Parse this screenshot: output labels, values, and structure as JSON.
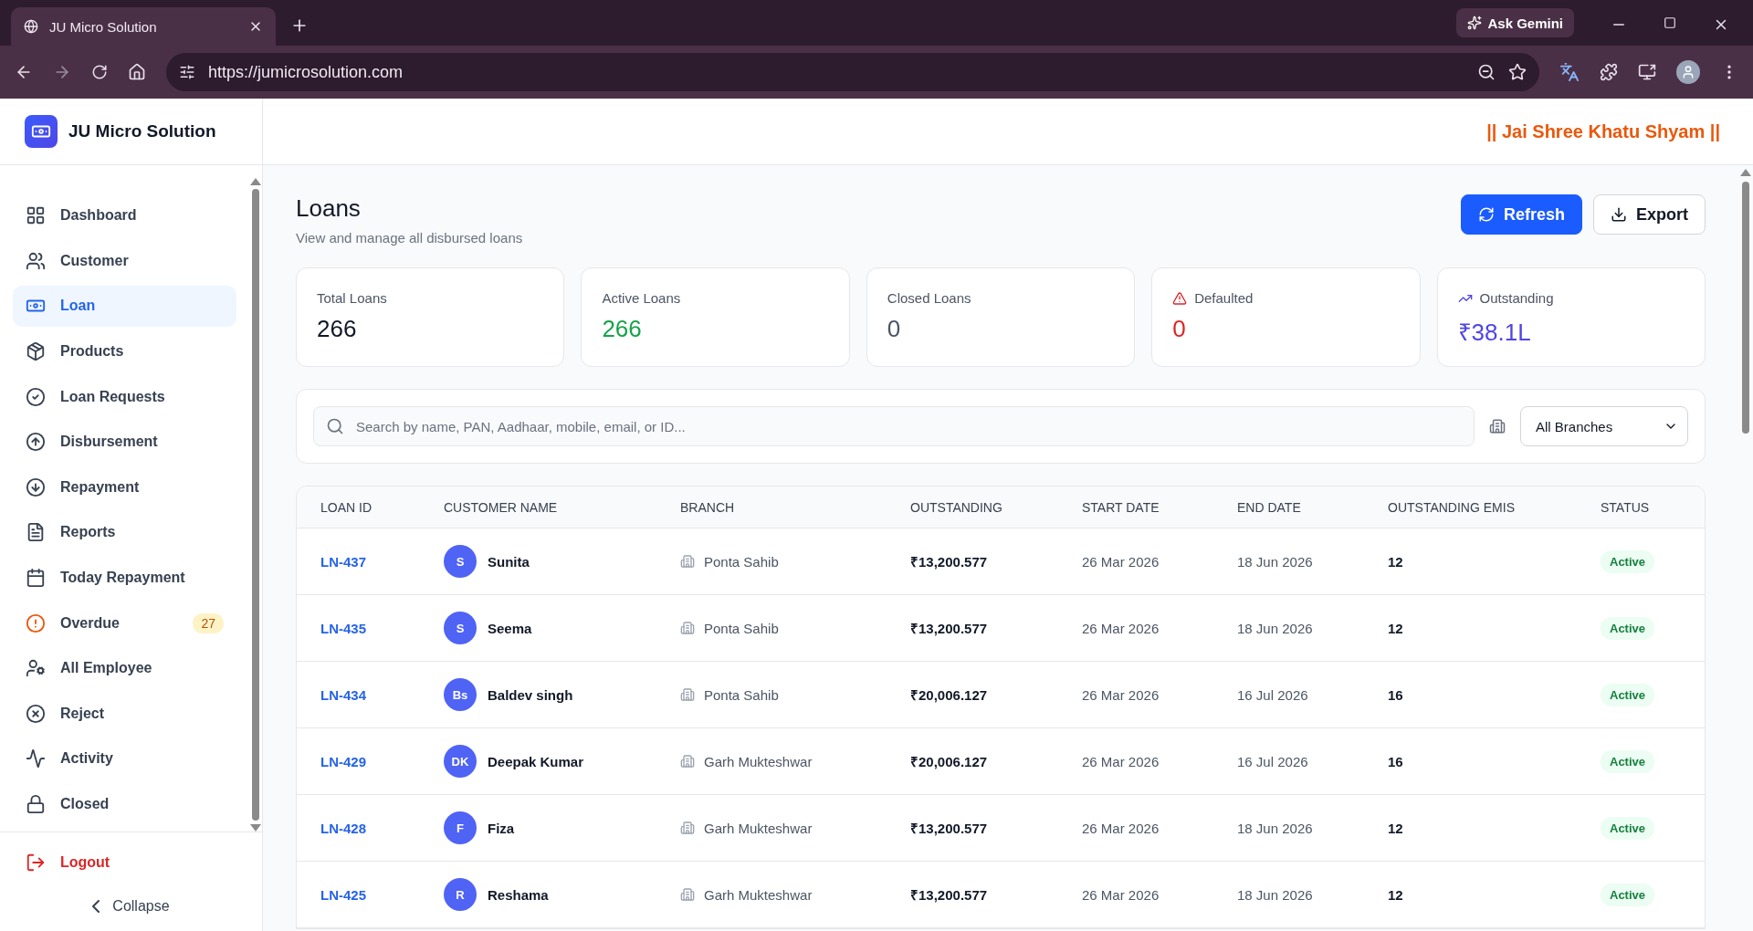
{
  "browser": {
    "tab_title": "JU Micro Solution",
    "url": "https://jumicrosolution.com",
    "gemini_label": "Ask Gemini"
  },
  "sidebar": {
    "brand": "JU Micro Solution",
    "items": [
      {
        "label": "Dashboard",
        "selected": false
      },
      {
        "label": "Customer",
        "selected": false
      },
      {
        "label": "Loan",
        "selected": true
      },
      {
        "label": "Products",
        "selected": false
      },
      {
        "label": "Loan Requests",
        "selected": false
      },
      {
        "label": "Disbursement",
        "selected": false
      },
      {
        "label": "Repayment",
        "selected": false
      },
      {
        "label": "Reports",
        "selected": false
      },
      {
        "label": "Today Repayment",
        "selected": false
      },
      {
        "label": "Overdue",
        "selected": false,
        "badge": "27"
      },
      {
        "label": "All Employee",
        "selected": false
      },
      {
        "label": "Reject",
        "selected": false
      },
      {
        "label": "Activity",
        "selected": false
      },
      {
        "label": "Closed",
        "selected": false
      }
    ],
    "logout": "Logout",
    "collapse": "Collapse"
  },
  "header": {
    "blessing": "|| Jai Shree Khatu Shyam ||"
  },
  "page": {
    "title": "Loans",
    "subtitle": "View and manage all disbursed loans",
    "buttons": [
      {
        "label": "Refresh",
        "kind": "primary"
      },
      {
        "label": "Export",
        "kind": "secondary"
      }
    ]
  },
  "stats": [
    {
      "label": "Total Loans",
      "value": "266",
      "color": "#111827",
      "kind": "plain"
    },
    {
      "label": "Active Loans",
      "value": "266",
      "color": "#16a34a",
      "kind": "plain"
    },
    {
      "label": "Closed Loans",
      "value": "0",
      "color": "#4b5563",
      "kind": "plain"
    },
    {
      "label": "Defaulted",
      "value": "0",
      "color": "#dc2626",
      "kind": "warning"
    },
    {
      "label": "Outstanding",
      "value": "₹38.1L",
      "color": "#4f46e5",
      "kind": "trend"
    }
  ],
  "filters": {
    "search_placeholder": "Search by name, PAN, Aadhaar, mobile, email, or ID...",
    "branch": "All Branches"
  },
  "table": {
    "columns": [
      "LOAN ID",
      "CUSTOMER NAME",
      "BRANCH",
      "OUTSTANDING",
      "START DATE",
      "END DATE",
      "OUTSTANDING EMIS",
      "STATUS"
    ],
    "rows": [
      {
        "id": "LN-437",
        "initials": "S",
        "name": "Sunita",
        "branch": "Ponta Sahib",
        "outstanding": "₹13,200.577",
        "start": "26 Mar 2026",
        "end": "18 Jun 2026",
        "emis": "12",
        "status": "Active"
      },
      {
        "id": "LN-435",
        "initials": "S",
        "name": "Seema",
        "branch": "Ponta Sahib",
        "outstanding": "₹13,200.577",
        "start": "26 Mar 2026",
        "end": "18 Jun 2026",
        "emis": "12",
        "status": "Active"
      },
      {
        "id": "LN-434",
        "initials": "Bs",
        "name": "Baldev singh",
        "branch": "Ponta Sahib",
        "outstanding": "₹20,006.127",
        "start": "26 Mar 2026",
        "end": "16 Jul 2026",
        "emis": "16",
        "status": "Active"
      },
      {
        "id": "LN-429",
        "initials": "DK",
        "name": "Deepak Kumar",
        "branch": "Garh Mukteshwar",
        "outstanding": "₹20,006.127",
        "start": "26 Mar 2026",
        "end": "16 Jul 2026",
        "emis": "16",
        "status": "Active"
      },
      {
        "id": "LN-428",
        "initials": "F",
        "name": "Fiza",
        "branch": "Garh Mukteshwar",
        "outstanding": "₹13,200.577",
        "start": "26 Mar 2026",
        "end": "18 Jun 2026",
        "emis": "12",
        "status": "Active"
      },
      {
        "id": "LN-425",
        "initials": "R",
        "name": "Reshama",
        "branch": "Garh Mukteshwar",
        "outstanding": "₹13,200.577",
        "start": "26 Mar 2026",
        "end": "18 Jun 2026",
        "emis": "12",
        "status": "Active"
      }
    ]
  }
}
